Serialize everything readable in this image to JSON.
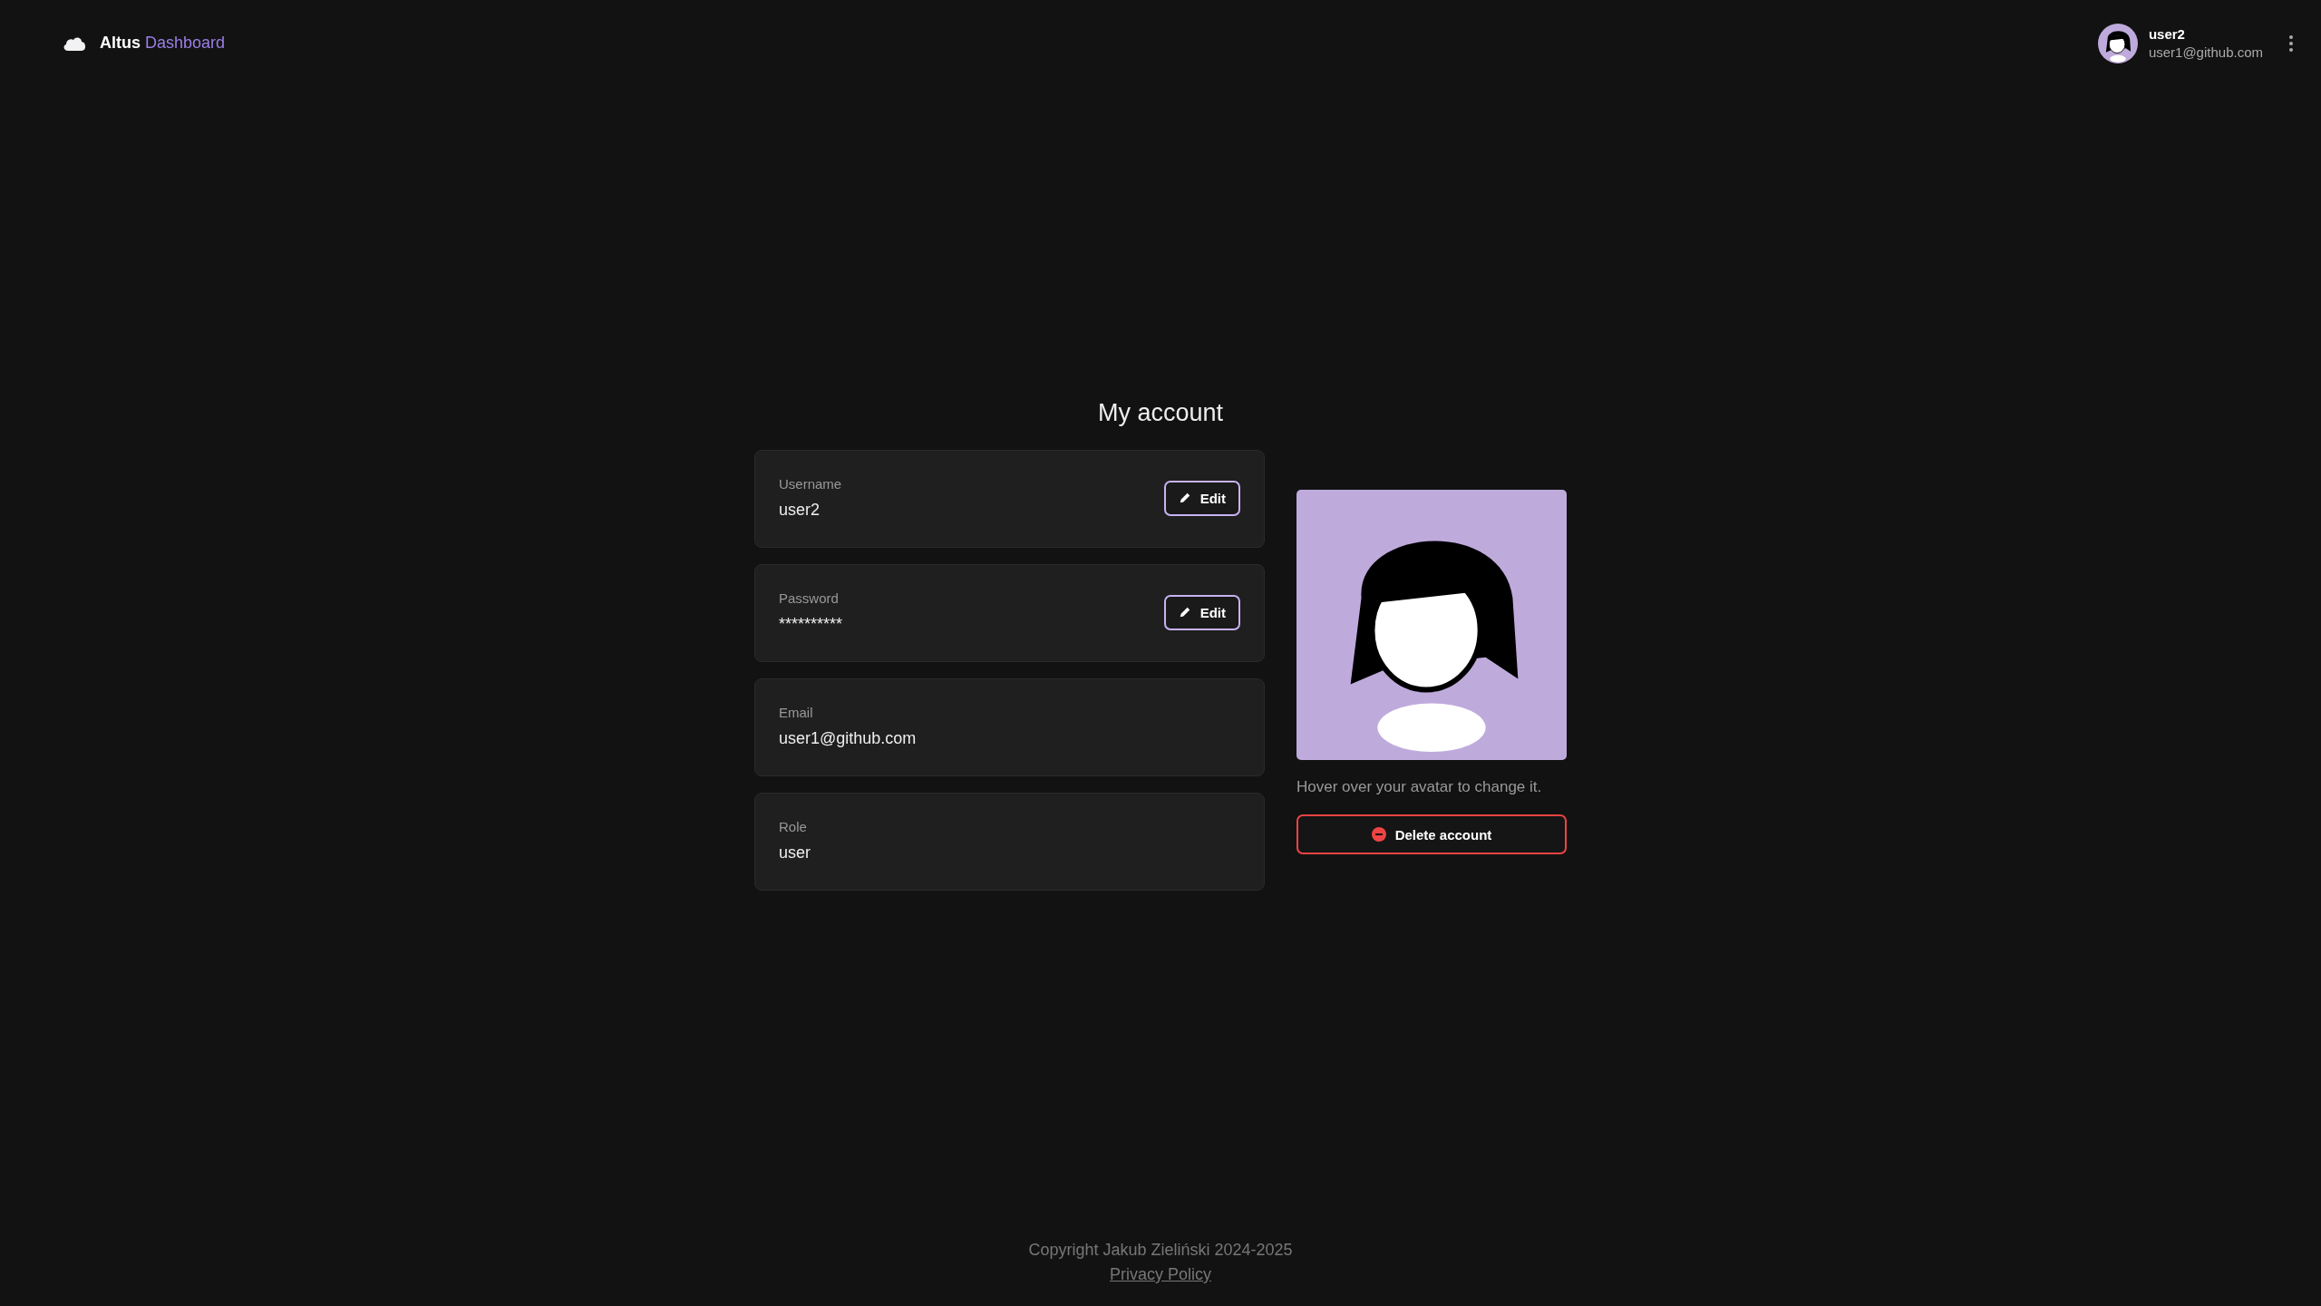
{
  "header": {
    "brand": {
      "first": "Altus",
      "second": "Dashboard"
    },
    "user": {
      "name": "user2",
      "email": "user1@github.com"
    }
  },
  "page": {
    "title": "My account",
    "fields": [
      {
        "label": "Username",
        "value": "user2",
        "action": "Edit"
      },
      {
        "label": "Password",
        "value": "**********",
        "action": "Edit"
      },
      {
        "label": "Email",
        "value": "user1@github.com"
      },
      {
        "label": "Role",
        "value": "user"
      }
    ],
    "avatar_hint": "Hover over your avatar to change it.",
    "delete_button": "Delete account"
  },
  "footer": {
    "copyright": "Copyright Jakub Zieliński 2024-2025",
    "link": "Privacy Policy"
  }
}
